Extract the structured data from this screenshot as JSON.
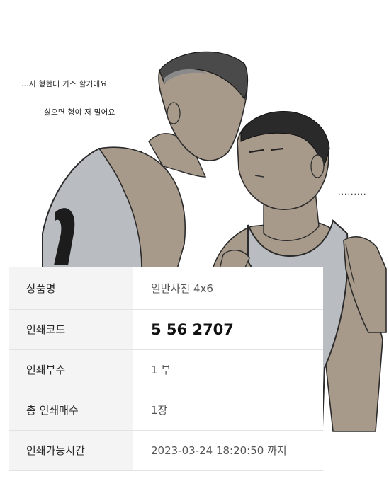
{
  "artwork": {
    "caption_lines": [
      "...저 형한테 기스 할거에요",
      "싫으면 형이 저 밀어요"
    ],
    "trailing_dots": "........."
  },
  "product_info": {
    "rows": [
      {
        "label": "상품명",
        "value": "일반사진 4x6"
      },
      {
        "label": "인쇄코드",
        "value": "5 56 2707"
      },
      {
        "label": "인쇄부수",
        "value": "1 부"
      },
      {
        "label": "총 인쇄매수",
        "value": "1장"
      },
      {
        "label": "인쇄가능시간",
        "value": "2023-03-24 18:20:50 까지"
      }
    ]
  }
}
